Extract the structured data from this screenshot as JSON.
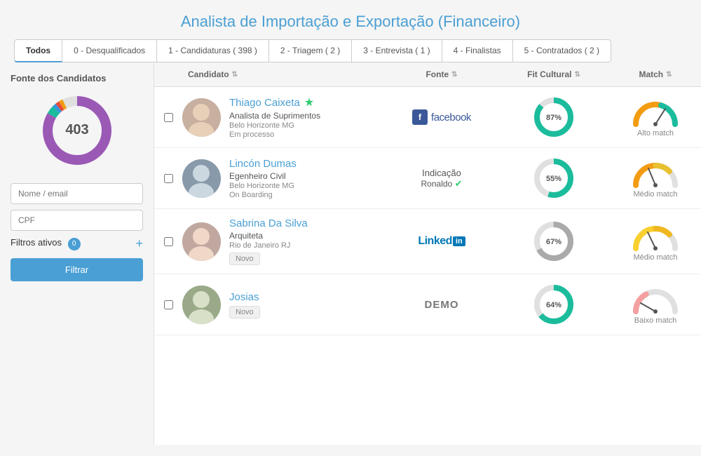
{
  "page": {
    "title": "Analista de Importação e Exportação (Financeiro)"
  },
  "tabs": [
    {
      "id": "todos",
      "label": "Todos",
      "active": true
    },
    {
      "id": "desqualificados",
      "label": "0 - Desqualificados",
      "active": false
    },
    {
      "id": "candidaturas",
      "label": "1 - Candidaturas ( 398 )",
      "active": false
    },
    {
      "id": "triagem",
      "label": "2 - Triagem ( 2 )",
      "active": false
    },
    {
      "id": "entrevista",
      "label": "3 - Entrevista ( 1 )",
      "active": false
    },
    {
      "id": "finalistas",
      "label": "4 - Finalistas",
      "active": false
    },
    {
      "id": "contratados",
      "label": "5 - Contratados ( 2 )",
      "active": false
    }
  ],
  "sidebar": {
    "source_title": "Fonte dos Candidatos",
    "total_count": "403",
    "name_email_placeholder": "Nome / email",
    "cpf_placeholder": "CPF",
    "filtros_label": "Filtros ativos",
    "filtros_count": "0",
    "filtrar_btn": "Filtrar"
  },
  "table": {
    "headers": {
      "candidato": "Candidato",
      "fonte": "Fonte",
      "fit_cultural": "Fit Cultural",
      "match": "Match"
    },
    "rows": [
      {
        "id": 1,
        "name": "Thiago Caixeta",
        "star": true,
        "role": "Analista de Suprimentos",
        "location": "Belo Horizonte MG",
        "status": "Em processo",
        "badge": null,
        "fonte_type": "facebook",
        "fonte_label": "facebook",
        "fit_pct": 87,
        "fit_color": "#1abc9c",
        "match_level": "alto",
        "match_label": "Alto match",
        "avatar_color": "#b0a090"
      },
      {
        "id": 2,
        "name": "Lincón Dumas",
        "star": false,
        "role": "Egenheiro Civil",
        "location": "Belo Horizonte MG",
        "status": "On Boarding",
        "badge": null,
        "fonte_type": "indicacao",
        "fonte_label": "Indicação",
        "fonte_person": "Ronaldo",
        "fit_pct": 55,
        "fit_color": "#1abc9c",
        "match_level": "medio",
        "match_label": "Médio match",
        "avatar_color": "#8899aa"
      },
      {
        "id": 3,
        "name": "Sabrina Da Silva",
        "star": false,
        "role": "Arquiteta",
        "location": "Rio de Janeiro RJ",
        "status": null,
        "badge": "Novo",
        "fonte_type": "linkedin",
        "fonte_label": "LinkedIn",
        "fit_pct": 67,
        "fit_color": "#aaa",
        "match_level": "medio",
        "match_label": "Médio match",
        "avatar_color": "#c0a8a0"
      },
      {
        "id": 4,
        "name": "Josias",
        "star": false,
        "role": "",
        "location": "",
        "status": null,
        "badge": "Novo",
        "fonte_type": "demo",
        "fonte_label": "DEMO",
        "fit_pct": 64,
        "fit_color": "#1abc9c",
        "match_level": "baixo",
        "match_label": "Baixo match",
        "avatar_color": "#9aaa88"
      }
    ]
  }
}
